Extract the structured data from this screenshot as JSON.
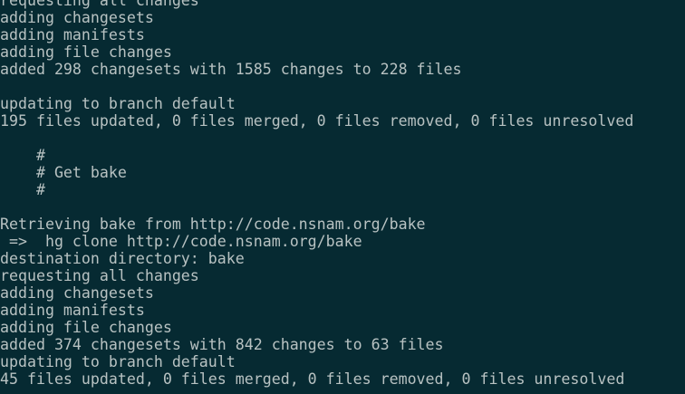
{
  "terminal": {
    "background": "#062a32",
    "text_color": "#b8c2c2",
    "lines": [
      "requesting all changes",
      "adding changesets",
      "adding manifests",
      "adding file changes",
      "added 298 changesets with 1585 changes to 228 files",
      "",
      "updating to branch default",
      "195 files updated, 0 files merged, 0 files removed, 0 files unresolved",
      "",
      "    #",
      "    # Get bake",
      "    #",
      "",
      "Retrieving bake from http://code.nsnam.org/bake",
      " =>  hg clone http://code.nsnam.org/bake",
      "destination directory: bake",
      "requesting all changes",
      "adding changesets",
      "adding manifests",
      "adding file changes",
      "added 374 changesets with 842 changes to 63 files",
      "updating to branch default",
      "45 files updated, 0 files merged, 0 files removed, 0 files unresolved"
    ]
  }
}
